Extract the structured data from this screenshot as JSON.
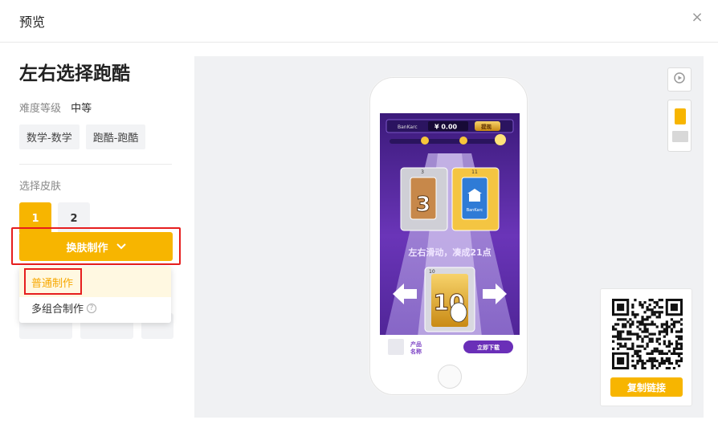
{
  "header": {
    "title": "预览",
    "close_label": "×"
  },
  "game": {
    "title": "左右选择跑酷",
    "difficulty_label": "难度等级",
    "difficulty_value": "中等",
    "tags": [
      "数学-数学",
      "跑酷-跑酷"
    ]
  },
  "skins": {
    "label": "选择皮肤",
    "options": [
      "1",
      "2"
    ],
    "selected": "1"
  },
  "make_button": {
    "label": "换肤制作",
    "chevron": "⌄"
  },
  "dropdown": {
    "items": [
      "普通制作",
      "多组合制作"
    ],
    "help_icon": "?"
  },
  "preview": {
    "qr": {
      "copy_label": "复制链接"
    },
    "game_screen": {
      "brand": "BanKarc",
      "balance": "¥ 0.00",
      "withdraw": "提现",
      "card_left_small": "3",
      "card_left_big": "3",
      "card_right_small": "11",
      "instruction": "左右滑动，凑成21点",
      "hand_card_corner": "10",
      "hand_card_value": "10",
      "footer_product": "产品",
      "footer_name": "名称",
      "download_label": "立即下载"
    }
  },
  "colors": {
    "accent": "#f7b500",
    "highlight_border": "#e61e1e",
    "game_bg": "#5a2d9c"
  }
}
